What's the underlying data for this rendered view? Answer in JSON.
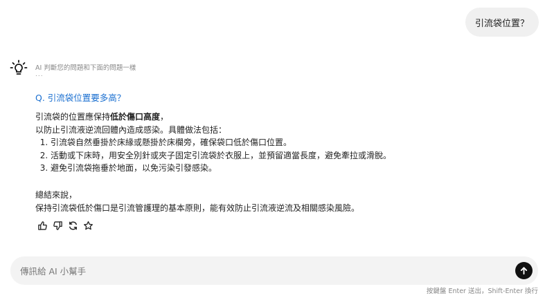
{
  "user_message": "引流袋位置？",
  "ai": {
    "avatar_icon": "lightbulb-icon",
    "note": "AI 判斷您的問題和下面的問題一樣",
    "note_ellipsis": "...",
    "question_title": "Q. 引流袋位置要多高？",
    "answer": {
      "line1_prefix": "引流袋的位置應保持",
      "line1_bold": "低於傷口高度",
      "line1_suffix": "，",
      "line2": "以防止引流液逆流回體內造成感染。具體做法包括：",
      "steps": [
        "引流袋自然垂掛於床緣或懸掛於床欄旁，確保袋口低於傷口位置。",
        "活動或下床時，用安全別針或夾子固定引流袋於衣服上，並預留適當長度，避免牽拉或滑脫。",
        "避免引流袋拖垂於地面，以免污染引發感染。"
      ]
    },
    "summary": {
      "line1": "總結來說，",
      "line2": "保持引流袋低於傷口是引流管護理的基本原則，能有效防止引流液逆流及相關感染風險。"
    },
    "actions": [
      "thumbs-up-icon",
      "thumbs-down-icon",
      "regenerate-icon",
      "star-icon"
    ]
  },
  "composer": {
    "placeholder": "傳訊給 AI 小幫手",
    "send_icon": "arrow-up-icon"
  },
  "hint": "按鍵盤 Enter 送出，Shift-Enter 換行",
  "colors": {
    "accent": "#1a6fd0",
    "bubble": "#f0f0f0",
    "composer": "#f3f3f3",
    "send": "#111111"
  }
}
